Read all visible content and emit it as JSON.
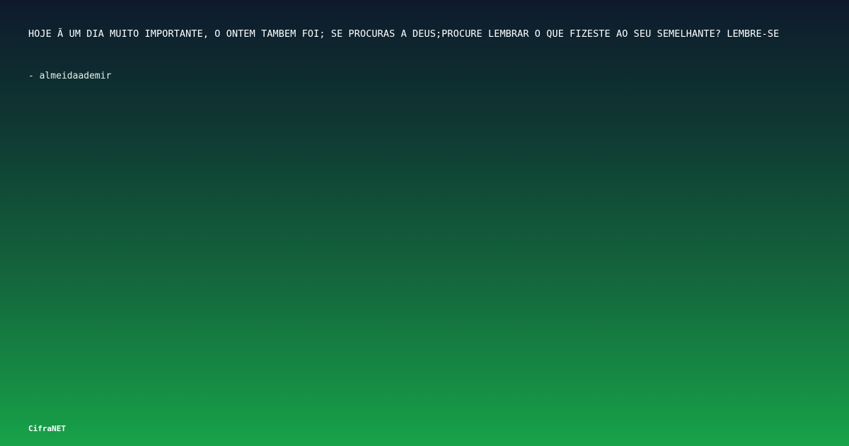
{
  "quote": {
    "text": "HOJE Ã  UM DIA MUITO IMPORTANTE, O ONTEM TAMBEM FOI; SE PROCURAS A DEUS;PROCURE LEMBRAR O QUE FIZESTE AO SEU SEMELHANTE? LEMBRE-SE"
  },
  "author": {
    "text": "- almeidaademir"
  },
  "brand": {
    "name": "CifraNET"
  }
}
